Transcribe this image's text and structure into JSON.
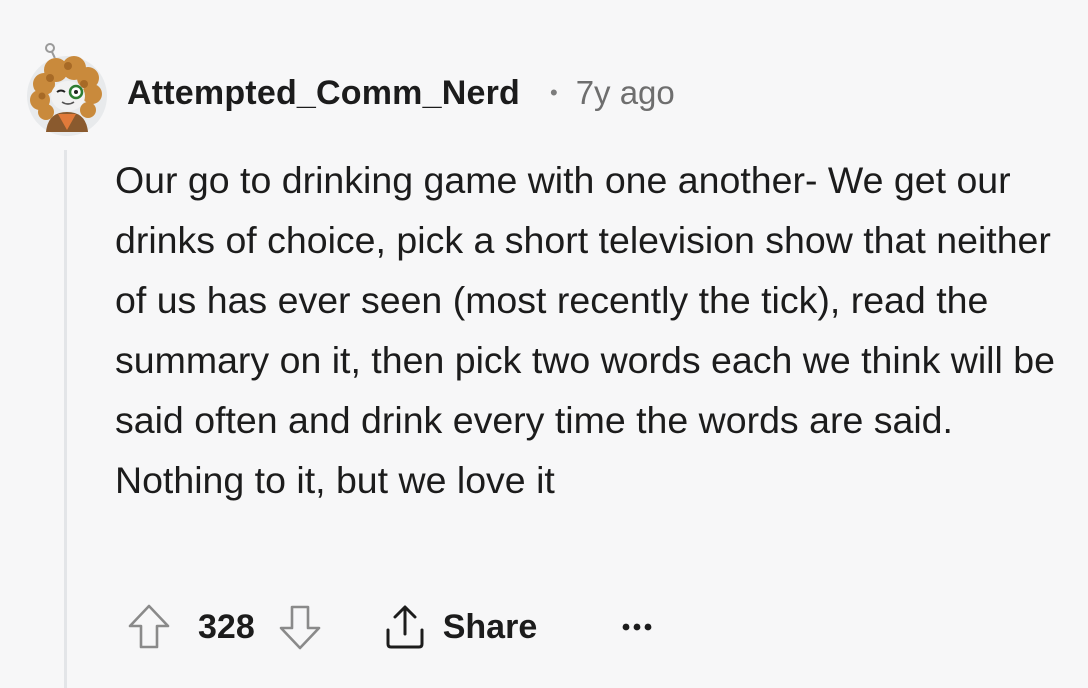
{
  "comment": {
    "author": "Attempted_Comm_Nerd",
    "separator": "•",
    "age": "7y ago",
    "body": "Our go to drinking game with one another- We get our drinks of choice, pick a short television show that neither of us has ever seen (most recently the tick), read the summary on it, then pick two words each we think will be said often and drink every time the words are said. Nothing to it, but we love it"
  },
  "actions": {
    "score": "328",
    "share_label": "Share",
    "upvote_icon": "arrow-up-icon",
    "downvote_icon": "arrow-down-icon",
    "share_icon": "share-icon",
    "more_icon": "more-options-icon"
  },
  "colors": {
    "background": "#f7f7f8",
    "text": "#1c1c1c",
    "muted": "#6e6e6e",
    "thread_line": "#e3e5e8"
  }
}
